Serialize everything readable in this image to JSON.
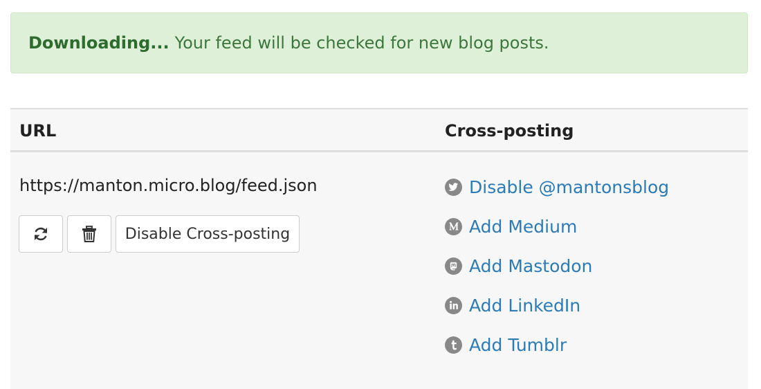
{
  "alert": {
    "title": "Downloading...",
    "message": "Your feed will be checked for new blog posts."
  },
  "table": {
    "headers": {
      "url": "URL",
      "crossposting": "Cross-posting"
    },
    "feed": {
      "url": "https://manton.micro.blog/feed.json",
      "disable_crossposting_label": "Disable Cross-posting"
    },
    "services": [
      {
        "icon": "twitter-icon",
        "label": "Disable @mantonsblog"
      },
      {
        "icon": "medium-icon",
        "label": "Add Medium"
      },
      {
        "icon": "mastodon-icon",
        "label": "Add Mastodon"
      },
      {
        "icon": "linkedin-icon",
        "label": "Add LinkedIn"
      },
      {
        "icon": "tumblr-icon",
        "label": "Add Tumblr"
      }
    ]
  },
  "colors": {
    "alert_bg": "#dff0d8",
    "alert_text": "#3c763d",
    "link": "#2b7bb9",
    "icon_gray": "#888888"
  }
}
